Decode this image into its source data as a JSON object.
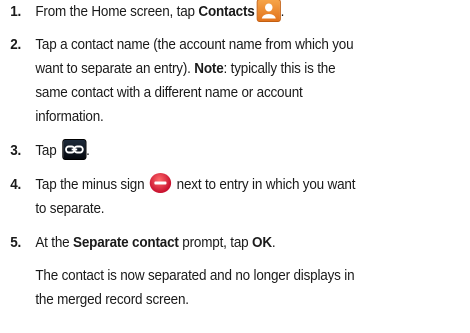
{
  "steps": [
    {
      "num": "1.",
      "pre": "From the Home screen, tap ",
      "bold": "Contacts",
      "icon": "contacts-icon",
      "post": "."
    },
    {
      "num": "2.",
      "line1": "Tap a contact name (the account name from which you",
      "line2_pre": "want to separate an entry). ",
      "note_label": "Note",
      "line2_post": ": typically this is the",
      "line3": "same contact with a different name or account",
      "line4": "information."
    },
    {
      "num": "3.",
      "pre": "Tap ",
      "icon": "link-icon",
      "post": "."
    },
    {
      "num": "4.",
      "pre": "Tap the minus sign ",
      "icon": "minus-sign-icon",
      "post": " next to entry in which you want",
      "line2": "to separate."
    },
    {
      "num": "5.",
      "pre": "At the ",
      "bold1": "Separate contact",
      "mid": " prompt, tap ",
      "bold2": "OK",
      "post": ".",
      "result1": "The contact is now separated and no longer displays in",
      "result2": "the merged record screen."
    }
  ],
  "colors": {
    "text": "#1a1a1a",
    "contacts_icon": "#f08c2c",
    "link_icon": "#0b1018",
    "minus_icon": "#d0132f"
  }
}
